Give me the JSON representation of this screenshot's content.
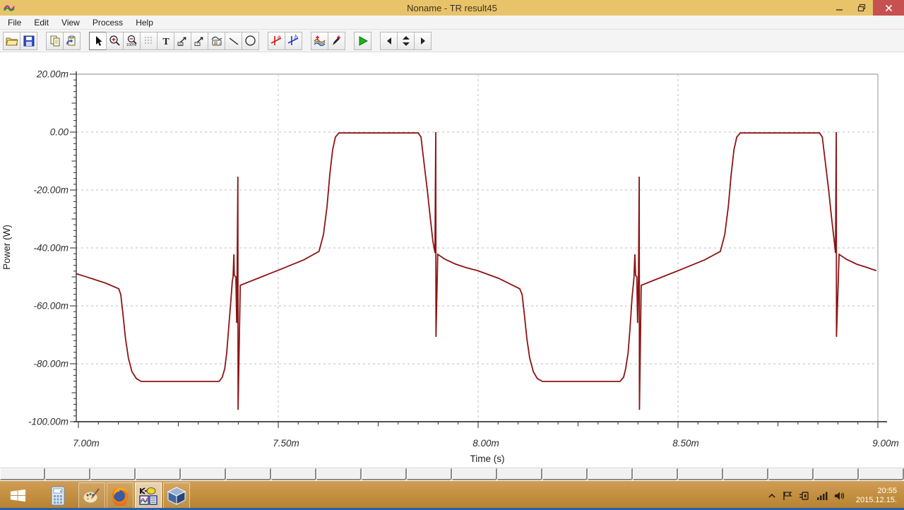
{
  "window": {
    "title": "Noname - TR result45",
    "app_icon": "tina-app-icon",
    "controls": [
      "minimize",
      "restore",
      "close"
    ]
  },
  "menu": {
    "items": [
      "File",
      "Edit",
      "View",
      "Process",
      "Help"
    ]
  },
  "toolbar": {
    "buttons": [
      "open",
      "save",
      "copy",
      "paste",
      "select-pointer",
      "zoom-in",
      "zoom-100",
      "grid",
      "text-tool",
      "arrow-annotation-1",
      "arrow-annotation-2",
      "legend-box",
      "line-tool",
      "ellipse-tool",
      "cursor-a",
      "cursor-b",
      "add-curve",
      "add-probe",
      "run",
      "page-left",
      "page-spinner",
      "page-right"
    ],
    "active_button": "select-pointer"
  },
  "chart_data": {
    "type": "line",
    "title": "",
    "xlabel": "Time (s)",
    "ylabel": "Power (W)",
    "xlim_ms": [
      7.0,
      9.0
    ],
    "ylim_mW": [
      -100,
      20
    ],
    "grid": "dashed-major",
    "xticks": [
      {
        "label": "7.00m",
        "value_ms": 7.0
      },
      {
        "label": "7.50m",
        "value_ms": 7.5
      },
      {
        "label": "8.00m",
        "value_ms": 8.0
      },
      {
        "label": "8.50m",
        "value_ms": 8.5
      },
      {
        "label": "9.00m",
        "value_ms": 9.0
      }
    ],
    "yticks": [
      {
        "label": "20.00m",
        "value_mW": 20
      },
      {
        "label": "0.00",
        "value_mW": 0
      },
      {
        "label": "-20.00m",
        "value_mW": -20
      },
      {
        "label": "-40.00m",
        "value_mW": -40
      },
      {
        "label": "-60.00m",
        "value_mW": -60
      },
      {
        "label": "-80.00m",
        "value_mW": -80
      },
      {
        "label": "-100.00m",
        "value_mW": -100
      }
    ],
    "series": [
      {
        "name": "Power",
        "color": "#8b1515",
        "points_ms_mW": [
          [
            6.995,
            -48.9
          ],
          [
            7.016,
            -49.8
          ],
          [
            7.069,
            -52.2
          ],
          [
            7.101,
            -54.1
          ],
          [
            7.106,
            -56.1
          ],
          [
            7.111,
            -62.2
          ],
          [
            7.118,
            -71.5
          ],
          [
            7.125,
            -78.0
          ],
          [
            7.134,
            -82.7
          ],
          [
            7.145,
            -85.1
          ],
          [
            7.157,
            -86.1
          ],
          [
            7.352,
            -86.1
          ],
          [
            7.36,
            -84.6
          ],
          [
            7.366,
            -81.7
          ],
          [
            7.371,
            -76.3
          ],
          [
            7.376,
            -67.6
          ],
          [
            7.382,
            -57.3
          ],
          [
            7.385,
            -51.5
          ],
          [
            7.387,
            -50.0
          ],
          [
            7.389,
            -42.2
          ],
          [
            7.39,
            -49.5
          ],
          [
            7.394,
            -50.0
          ],
          [
            7.396,
            -65.9
          ],
          [
            7.397,
            -50.5
          ],
          [
            7.399,
            -15.4
          ],
          [
            7.3995,
            -95.9
          ],
          [
            7.405,
            -52.9
          ],
          [
            7.458,
            -50.0
          ],
          [
            7.511,
            -47.1
          ],
          [
            7.564,
            -44.1
          ],
          [
            7.602,
            -41.2
          ],
          [
            7.613,
            -35.4
          ],
          [
            7.622,
            -25.6
          ],
          [
            7.629,
            -14.6
          ],
          [
            7.636,
            -6.1
          ],
          [
            7.643,
            -1.7
          ],
          [
            7.652,
            -0.3
          ],
          [
            7.85,
            -0.3
          ],
          [
            7.857,
            -1.7
          ],
          [
            7.864,
            -9.8
          ],
          [
            7.873,
            -20.2
          ],
          [
            7.88,
            -29.3
          ],
          [
            7.887,
            -37.8
          ],
          [
            7.892,
            -41.7
          ],
          [
            7.894,
            0.0
          ],
          [
            7.8945,
            -70.7
          ],
          [
            7.899,
            -42.2
          ],
          [
            7.917,
            -43.9
          ],
          [
            7.944,
            -45.6
          ],
          [
            7.97,
            -46.8
          ],
          [
            7.998,
            -47.8
          ],
          [
            8.051,
            -50.5
          ],
          [
            8.104,
            -54.1
          ],
          [
            8.11,
            -56.1
          ],
          [
            8.115,
            -62.2
          ],
          [
            8.122,
            -71.5
          ],
          [
            8.129,
            -78.0
          ],
          [
            8.138,
            -82.7
          ],
          [
            8.148,
            -85.1
          ],
          [
            8.161,
            -86.1
          ],
          [
            8.355,
            -86.1
          ],
          [
            8.364,
            -84.6
          ],
          [
            8.369,
            -81.7
          ],
          [
            8.375,
            -76.3
          ],
          [
            8.38,
            -67.6
          ],
          [
            8.385,
            -57.3
          ],
          [
            8.389,
            -51.5
          ],
          [
            8.39,
            -50.0
          ],
          [
            8.392,
            -42.2
          ],
          [
            8.394,
            -49.5
          ],
          [
            8.397,
            -50.0
          ],
          [
            8.399,
            -65.9
          ],
          [
            8.401,
            -50.5
          ],
          [
            8.403,
            -15.4
          ],
          [
            8.4035,
            -95.9
          ],
          [
            8.408,
            -52.9
          ],
          [
            8.461,
            -50.0
          ],
          [
            8.514,
            -47.1
          ],
          [
            8.567,
            -44.1
          ],
          [
            8.606,
            -41.2
          ],
          [
            8.617,
            -35.4
          ],
          [
            8.626,
            -25.6
          ],
          [
            8.633,
            -14.6
          ],
          [
            8.64,
            -6.1
          ],
          [
            8.647,
            -1.7
          ],
          [
            8.656,
            -0.3
          ],
          [
            8.854,
            -0.3
          ],
          [
            8.861,
            -1.7
          ],
          [
            8.868,
            -9.8
          ],
          [
            8.877,
            -20.2
          ],
          [
            8.884,
            -29.3
          ],
          [
            8.891,
            -37.8
          ],
          [
            8.894,
            -41.7
          ],
          [
            8.896,
            0.0
          ],
          [
            8.8965,
            -70.7
          ],
          [
            8.903,
            -42.2
          ],
          [
            8.921,
            -43.9
          ],
          [
            8.947,
            -45.6
          ],
          [
            8.974,
            -46.8
          ],
          [
            8.995,
            -47.8
          ]
        ]
      }
    ]
  },
  "page_tabs": {
    "count": 20
  },
  "taskbar": {
    "apps": [
      "start",
      "calculator",
      "paint",
      "firefox",
      "tina-diagram",
      "virtualbox"
    ],
    "active_app": "tina-diagram",
    "tray": {
      "icons": [
        "hidden-icons-chevron",
        "flag",
        "power-plug",
        "network-signal",
        "volume"
      ],
      "time": "20:55",
      "date": "2015.12.15."
    }
  },
  "colors": {
    "titlebar": "#e9c36a",
    "close_button": "#c75050",
    "curve": "#8b1515",
    "taskbar_top": "#d09d53",
    "taskbar_bottom": "#b5812f"
  }
}
